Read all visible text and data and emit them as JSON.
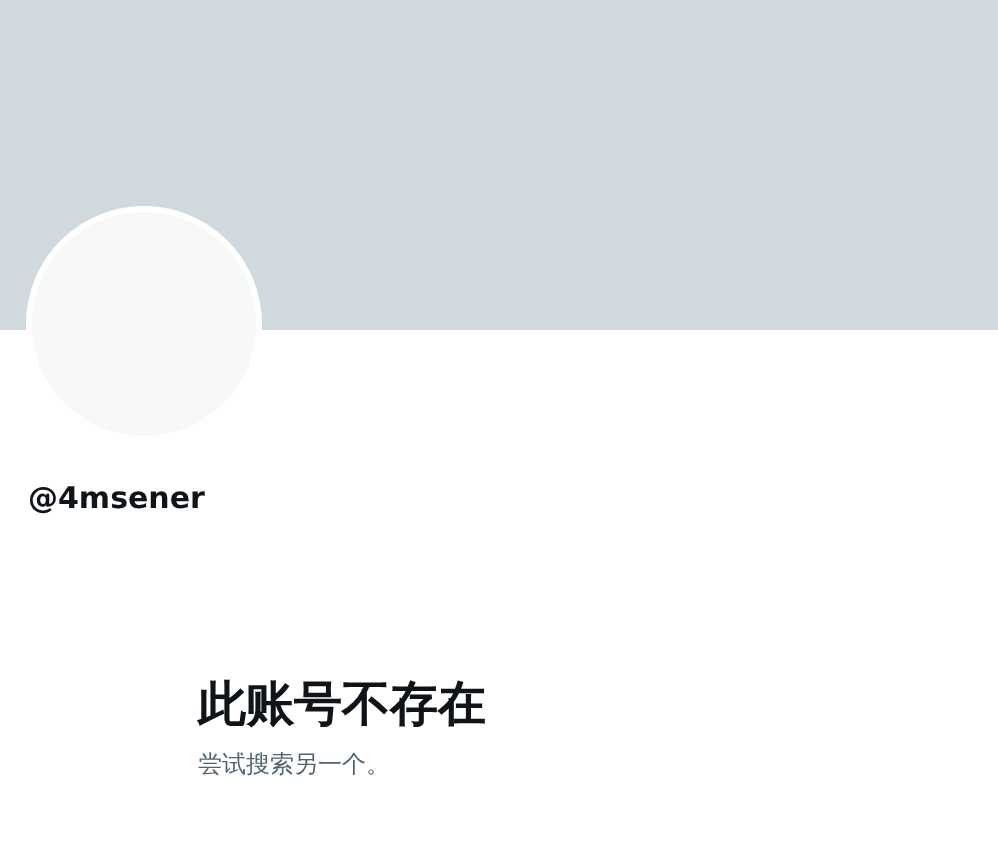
{
  "profile": {
    "handle": "@4msener"
  },
  "notice": {
    "title": "此账号不存在",
    "message": "尝试搜索另一个。"
  }
}
